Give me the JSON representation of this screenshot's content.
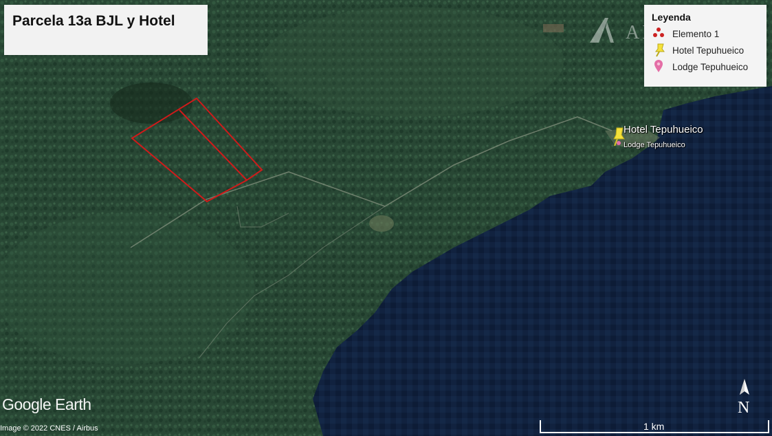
{
  "title": "Parcela 13a BJL y Hotel",
  "legend": {
    "heading": "Leyenda",
    "items": [
      {
        "label": "Elemento 1",
        "icon": "polygon-nodes-icon",
        "color": "#cc2222"
      },
      {
        "label": "Hotel Tepuhueico",
        "icon": "yellow-pushpin-icon",
        "color": "#f5e13a"
      },
      {
        "label": "Lodge Tepuhueico",
        "icon": "pink-placemark-icon",
        "color": "#e46ea6"
      }
    ]
  },
  "places": {
    "hotel": "Hotel Tepuhueico",
    "lodge": "Lodge Tepuhueico"
  },
  "map": {
    "logo": "Google Earth",
    "copyright": "Image © 2022 CNES / Airbus",
    "scale_label": "1 km",
    "north_label": "N",
    "watermark_text": "AL    NDES",
    "parcel_color": "#d11a1a",
    "forest_color": "#2a4a36",
    "water_color": "#0f1f3b"
  }
}
